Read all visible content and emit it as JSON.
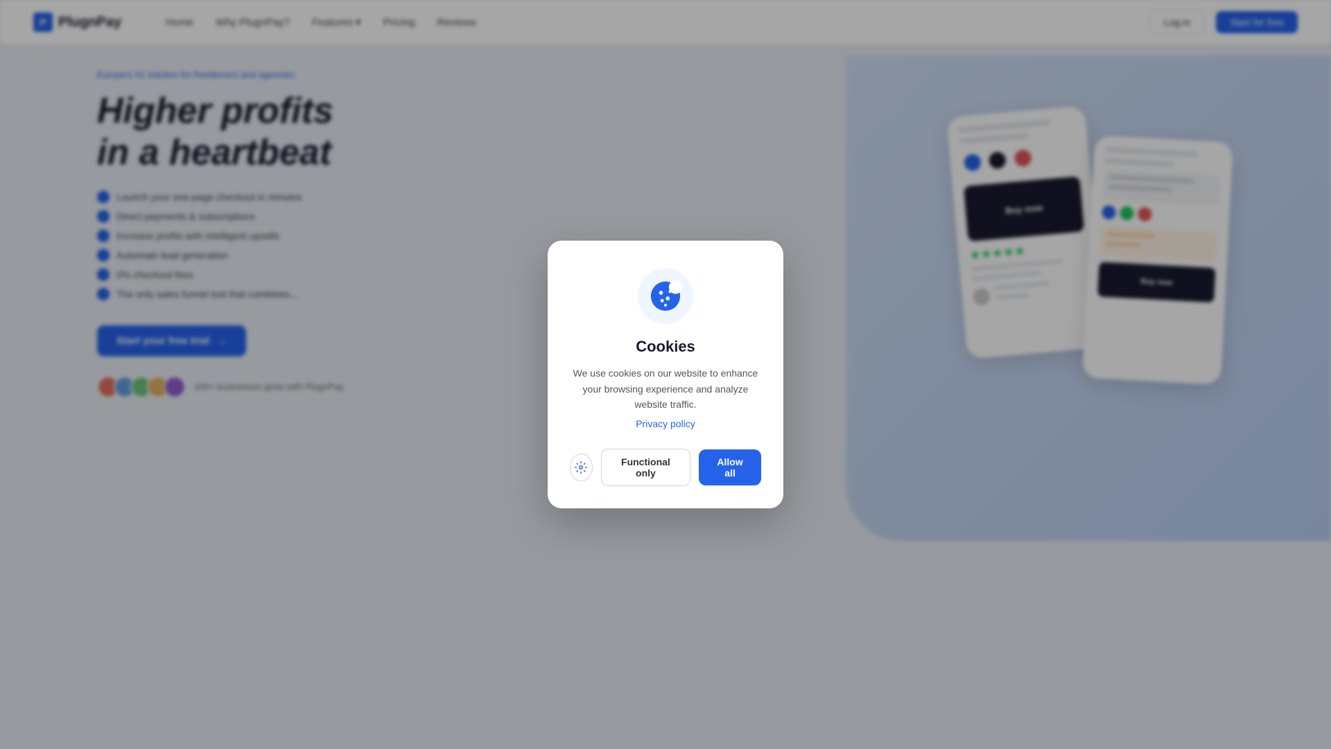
{
  "navbar": {
    "logo_text": "PlugnPay",
    "links": [
      {
        "label": "Home"
      },
      {
        "label": "Why PlugnPay?"
      },
      {
        "label": "Features",
        "has_dropdown": true
      },
      {
        "label": "Pricing"
      },
      {
        "label": "Reviews"
      }
    ],
    "btn_login": "Log in",
    "btn_start": "Start for free"
  },
  "hero": {
    "badge": "Europe's #1 solution for freelancers and agencies",
    "title_line1": "Higher profits",
    "title_line2": "in a heartbeat",
    "list_items": [
      "Launch your one-page checkout in minutes",
      "Direct payments & subscriptions",
      "Increase profits with intelligent upsells",
      "Automate lead generation",
      "0% checkout fees",
      "The only sales funnel tool that combines..."
    ],
    "btn_cta": "Start your free trial",
    "social_proof": "100+ businesses grow with PlugnPay"
  },
  "cookie_modal": {
    "icon_alt": "cookie",
    "title": "Cookies",
    "description": "We use cookies on our website to enhance your browsing experience and analyze website traffic.",
    "privacy_link": "Privacy policy",
    "btn_settings_label": "Settings",
    "btn_functional_label": "Functional only",
    "btn_allow_label": "Allow all"
  },
  "colors": {
    "primary": "#2563eb",
    "text_dark": "#1a1a2e",
    "text_muted": "#555555"
  }
}
